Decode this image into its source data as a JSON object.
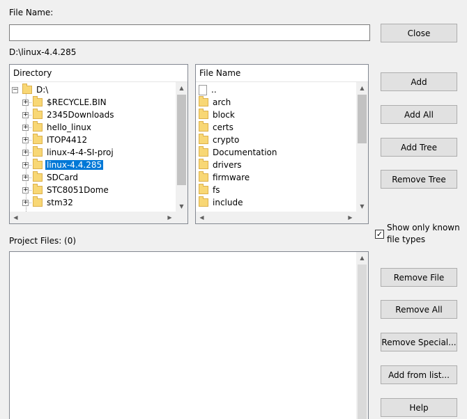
{
  "file_name": {
    "label": "File Name:",
    "value": ""
  },
  "current_path": "D:\\linux-4.4.285",
  "directory": {
    "header": "Directory",
    "root": "D:\\",
    "items": [
      {
        "label": "$RECYCLE.BIN"
      },
      {
        "label": "2345Downloads"
      },
      {
        "label": "hello_linux"
      },
      {
        "label": "ITOP4412"
      },
      {
        "label": "linux-4-4-SI-proj"
      },
      {
        "label": "linux-4.4.285",
        "selected": true
      },
      {
        "label": "SDCard"
      },
      {
        "label": "STC8051Dome"
      },
      {
        "label": "stm32"
      }
    ]
  },
  "files": {
    "header": "File Name",
    "items": [
      {
        "label": "..",
        "type": "doc"
      },
      {
        "label": "arch",
        "type": "folder"
      },
      {
        "label": "block",
        "type": "folder"
      },
      {
        "label": "certs",
        "type": "folder"
      },
      {
        "label": "crypto",
        "type": "folder"
      },
      {
        "label": "Documentation",
        "type": "folder"
      },
      {
        "label": "drivers",
        "type": "folder"
      },
      {
        "label": "firmware",
        "type": "folder"
      },
      {
        "label": "fs",
        "type": "folder"
      },
      {
        "label": "include",
        "type": "folder"
      }
    ]
  },
  "project_files": {
    "label": "Project Files: (0)"
  },
  "show_known": {
    "label_line1": "Show only known",
    "label_line2": "file types",
    "checked": true
  },
  "buttons": {
    "close": "Close",
    "add": "Add",
    "add_all": "Add All",
    "add_tree": "Add Tree",
    "remove_tree": "Remove Tree",
    "remove_file": "Remove File",
    "remove_all": "Remove All",
    "remove_special": "Remove Special...",
    "add_from_list": "Add from list...",
    "help": "Help"
  },
  "icons": {
    "expander": "plus-box-icon",
    "collapse": "minus-box-icon",
    "folder": "folder-icon",
    "document": "document-icon",
    "check": "checkmark-icon"
  }
}
